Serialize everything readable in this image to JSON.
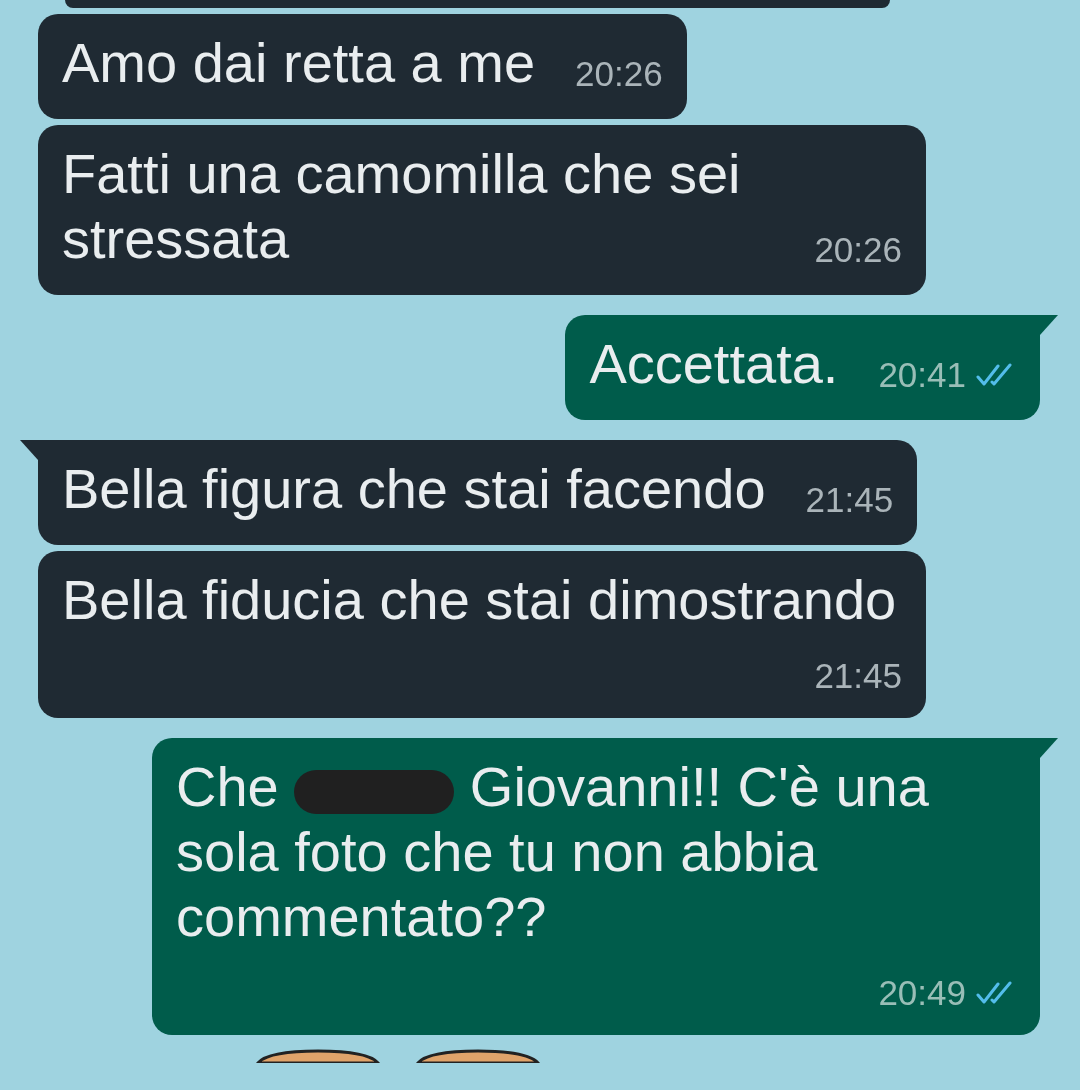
{
  "messages": [
    {
      "kind": "incoming",
      "partial": true
    },
    {
      "kind": "incoming",
      "tail": false,
      "segments": [
        {
          "kind": "text",
          "text": "Amo dai retta a me"
        }
      ],
      "time": "20:26"
    },
    {
      "kind": "incoming",
      "tail": false,
      "segments": [
        {
          "kind": "text",
          "text": "Fatti una camomilla che sei stressata"
        }
      ],
      "time": "20:26"
    },
    {
      "kind": "outgoing",
      "tail": true,
      "segments": [
        {
          "kind": "text",
          "text": "Accettata."
        }
      ],
      "time": "20:41",
      "read": true
    },
    {
      "kind": "incoming",
      "tail": true,
      "segments": [
        {
          "kind": "text",
          "text": "Bella figura che stai facendo"
        }
      ],
      "time": "21:45"
    },
    {
      "kind": "incoming",
      "tail": false,
      "segments": [
        {
          "kind": "text",
          "text": "Bella fiducia che stai dimostrando"
        }
      ],
      "time": "21:45"
    },
    {
      "kind": "outgoing",
      "tail": true,
      "segments": [
        {
          "kind": "text",
          "text": "Che"
        },
        {
          "kind": "redaction"
        },
        {
          "kind": "text",
          "text": "Giovanni!! C'è una"
        },
        {
          "kind": "block",
          "text": "sola foto che tu non abbia commentato??"
        }
      ],
      "time": "20:49",
      "read": true
    },
    {
      "kind": "sticker",
      "partial": true
    }
  ]
}
